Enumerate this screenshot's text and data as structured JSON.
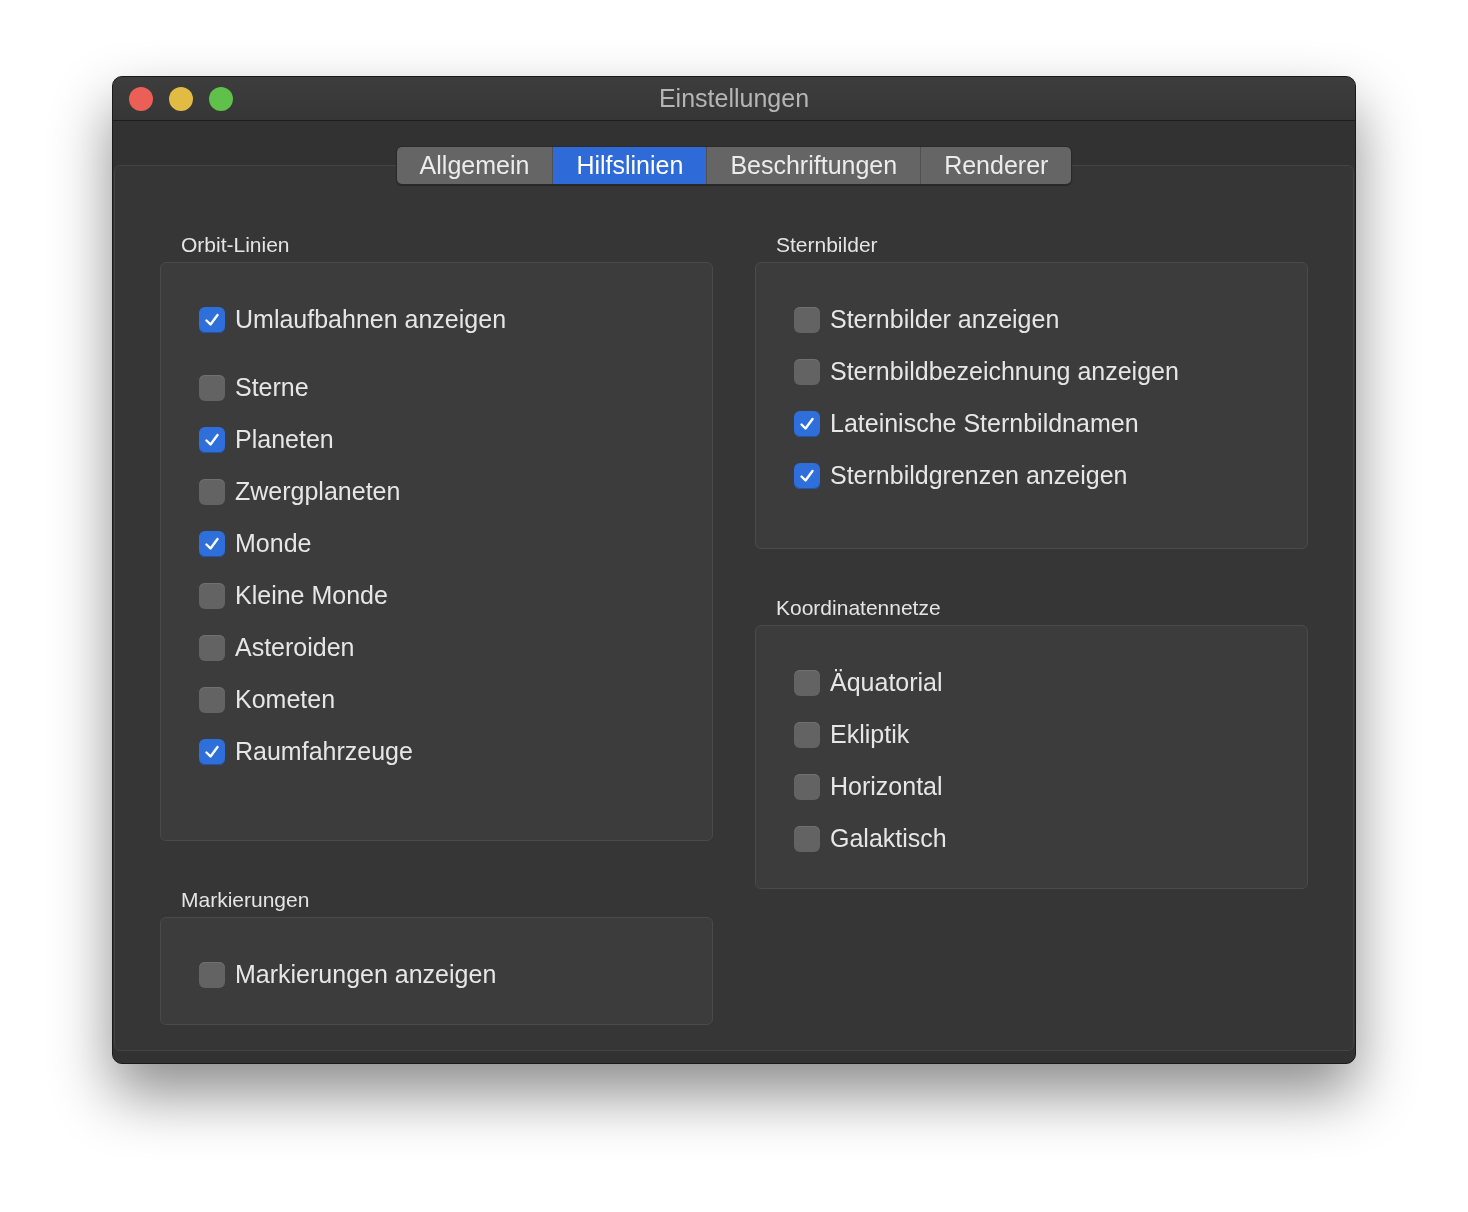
{
  "window": {
    "title": "Einstellungen"
  },
  "tabs": [
    {
      "label": "Allgemein",
      "selected": false
    },
    {
      "label": "Hilfslinien",
      "selected": true
    },
    {
      "label": "Beschriftungen",
      "selected": false
    },
    {
      "label": "Renderer",
      "selected": false
    }
  ],
  "columns": [
    {
      "groups": [
        {
          "title": "Orbit-Linien",
          "items": [
            {
              "kind": "master",
              "label": "Umlaufbahnen anzeigen",
              "checked": true
            },
            {
              "kind": "option",
              "label": "Sterne",
              "checked": false
            },
            {
              "kind": "option",
              "label": "Planeten",
              "checked": true
            },
            {
              "kind": "option",
              "label": "Zwergplaneten",
              "checked": false
            },
            {
              "kind": "option",
              "label": "Monde",
              "checked": true
            },
            {
              "kind": "option",
              "label": "Kleine Monde",
              "checked": false
            },
            {
              "kind": "option",
              "label": "Asteroiden",
              "checked": false
            },
            {
              "kind": "option",
              "label": "Kometen",
              "checked": false
            },
            {
              "kind": "option",
              "label": "Raumfahrzeuge",
              "checked": true
            }
          ]
        },
        {
          "title": "Markierungen",
          "items": [
            {
              "kind": "option",
              "label": "Markierungen anzeigen",
              "checked": false
            }
          ]
        }
      ]
    },
    {
      "groups": [
        {
          "title": "Sternbilder",
          "items": [
            {
              "kind": "option",
              "label": "Sternbilder anzeigen",
              "checked": false
            },
            {
              "kind": "option",
              "label": "Sternbildbezeichnung anzeigen",
              "checked": false
            },
            {
              "kind": "option",
              "label": "Lateinische Sternbildnamen",
              "checked": true
            },
            {
              "kind": "option",
              "label": "Sternbildgrenzen anzeigen",
              "checked": true
            }
          ]
        },
        {
          "title": "Koordinatennetze",
          "items": [
            {
              "kind": "option",
              "label": "Äquatorial",
              "checked": false
            },
            {
              "kind": "option",
              "label": "Ekliptik",
              "checked": false
            },
            {
              "kind": "option",
              "label": "Horizontal",
              "checked": false
            },
            {
              "kind": "option",
              "label": "Galaktisch",
              "checked": false
            }
          ]
        }
      ]
    }
  ]
}
